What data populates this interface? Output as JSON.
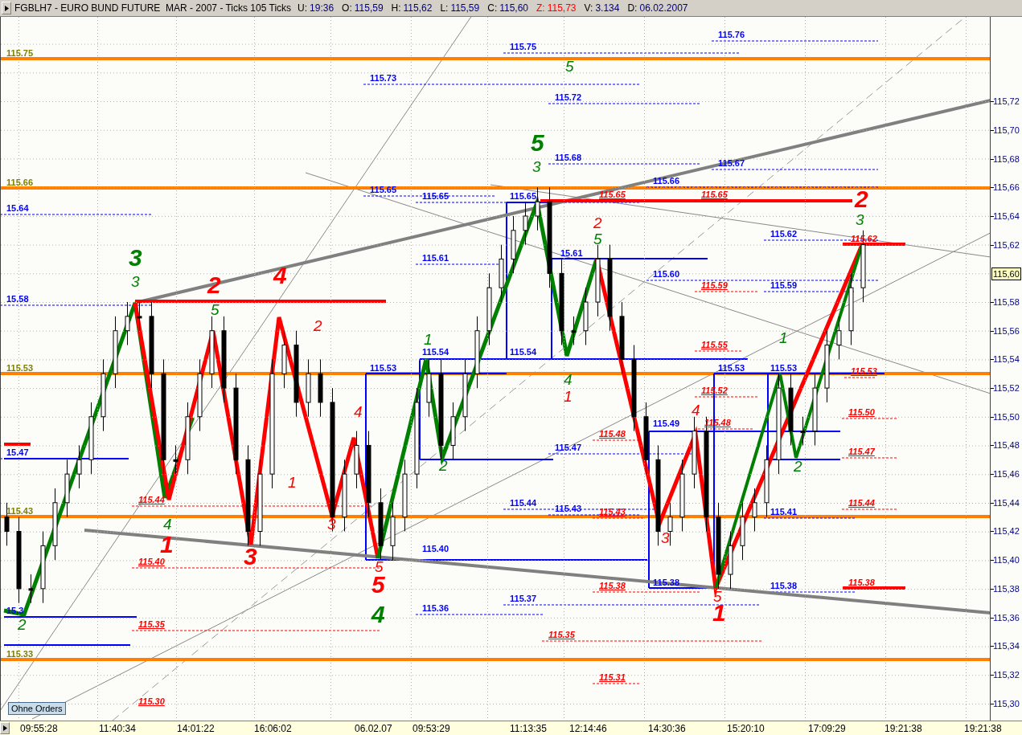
{
  "header": {
    "title": "FGBLH7 - EURO BUND FUTURE  MAR - 2007 - Ticks 105 Ticks",
    "fields": [
      {
        "label": "U:",
        "value": "19:36",
        "kind": "normal"
      },
      {
        "label": "O:",
        "value": "115,59",
        "kind": "normal"
      },
      {
        "label": "H:",
        "value": "115,62",
        "kind": "normal"
      },
      {
        "label": "L:",
        "value": "115,59",
        "kind": "normal"
      },
      {
        "label": "C:",
        "value": "115,60",
        "kind": "normal"
      },
      {
        "label": "Z:",
        "value": "115,73",
        "kind": "alert"
      },
      {
        "label": "V:",
        "value": "3.134",
        "kind": "normal"
      },
      {
        "label": "D:",
        "value": "06.02.2007",
        "kind": "normal"
      }
    ]
  },
  "level_labels": [
    {
      "text": "115.75",
      "kind": "pivot"
    },
    {
      "text": "115.66",
      "kind": "pivot"
    },
    {
      "text": "115.53",
      "kind": "pivot"
    },
    {
      "text": "115.43",
      "kind": "pivot"
    },
    {
      "text": "115.33",
      "kind": "pivot"
    },
    {
      "text": "115.76",
      "kind": "blue"
    },
    {
      "text": "115.75",
      "kind": "blue"
    },
    {
      "text": "115.73",
      "kind": "blue"
    },
    {
      "text": "115.72",
      "kind": "blue"
    },
    {
      "text": "115.68",
      "kind": "blue"
    },
    {
      "text": "115.67",
      "kind": "blue"
    },
    {
      "text": "115.66",
      "kind": "blue"
    },
    {
      "text": "115.65",
      "kind": "blue"
    },
    {
      "text": "115.65",
      "kind": "blue"
    },
    {
      "text": "115.65",
      "kind": "blue"
    },
    {
      "text": "15.64",
      "kind": "blue"
    },
    {
      "text": "115.62",
      "kind": "blue"
    },
    {
      "text": "115.61",
      "kind": "blue"
    },
    {
      "text": "15.61",
      "kind": "blue"
    },
    {
      "text": "115.60",
      "kind": "blue"
    },
    {
      "text": "115.59",
      "kind": "blue"
    },
    {
      "text": "15.58",
      "kind": "blue"
    },
    {
      "text": "115.54",
      "kind": "blue"
    },
    {
      "text": "115.54",
      "kind": "blue"
    },
    {
      "text": "115.53",
      "kind": "blue"
    },
    {
      "text": "115.53",
      "kind": "blue"
    },
    {
      "text": "115.53",
      "kind": "blue"
    },
    {
      "text": "115.49",
      "kind": "blue"
    },
    {
      "text": "115.47",
      "kind": "blue"
    },
    {
      "text": "15.47",
      "kind": "blue"
    },
    {
      "text": "115.44",
      "kind": "blue"
    },
    {
      "text": "115.43",
      "kind": "blue"
    },
    {
      "text": "115.41",
      "kind": "blue"
    },
    {
      "text": "115.40",
      "kind": "blue"
    },
    {
      "text": "115.38",
      "kind": "blue"
    },
    {
      "text": "115.38",
      "kind": "blue"
    },
    {
      "text": "115.37",
      "kind": "blue"
    },
    {
      "text": "115.36",
      "kind": "blue"
    },
    {
      "text": "15.3",
      "kind": "blue"
    },
    {
      "text": "115.65",
      "kind": "red"
    },
    {
      "text": "115.65",
      "kind": "red"
    },
    {
      "text": "115.62",
      "kind": "red"
    },
    {
      "text": "115.59",
      "kind": "red"
    },
    {
      "text": "115.55",
      "kind": "red"
    },
    {
      "text": "115.53",
      "kind": "red"
    },
    {
      "text": "115.52",
      "kind": "red"
    },
    {
      "text": "115.50",
      "kind": "red"
    },
    {
      "text": "115.48",
      "kind": "red"
    },
    {
      "text": "115.48",
      "kind": "red"
    },
    {
      "text": "115.47",
      "kind": "red"
    },
    {
      "text": "115.44",
      "kind": "red"
    },
    {
      "text": "115.44",
      "kind": "red"
    },
    {
      "text": "115.43",
      "kind": "red"
    },
    {
      "text": "115.40",
      "kind": "red"
    },
    {
      "text": "115.38",
      "kind": "red"
    },
    {
      "text": "115.38",
      "kind": "red"
    },
    {
      "text": "115.35",
      "kind": "red"
    },
    {
      "text": "115.35",
      "kind": "red"
    },
    {
      "text": "115.31",
      "kind": "red"
    },
    {
      "text": "115.30",
      "kind": "red"
    }
  ],
  "wave_labels": [
    {
      "text": "3",
      "kind": "major",
      "color": "#008000"
    },
    {
      "text": "5",
      "kind": "major",
      "color": "#008000"
    },
    {
      "text": "4",
      "kind": "major",
      "color": "#008000"
    },
    {
      "text": "3",
      "kind": "minor",
      "color": "#008000"
    },
    {
      "text": "5",
      "kind": "minor",
      "color": "#008000"
    },
    {
      "text": "4",
      "kind": "minor",
      "color": "#008000"
    },
    {
      "text": "2",
      "kind": "minor",
      "color": "#008000"
    },
    {
      "text": "1",
      "kind": "minor",
      "color": "#008000"
    },
    {
      "text": "2",
      "kind": "minor",
      "color": "#008000"
    },
    {
      "text": "3",
      "kind": "minor",
      "color": "#008000"
    },
    {
      "text": "5",
      "kind": "minor",
      "color": "#008000"
    },
    {
      "text": "5",
      "kind": "minor",
      "color": "#008000"
    },
    {
      "text": "4",
      "kind": "minor",
      "color": "#008000"
    },
    {
      "text": "1",
      "kind": "minor",
      "color": "#008000"
    },
    {
      "text": "2",
      "kind": "minor",
      "color": "#008000"
    },
    {
      "text": "3",
      "kind": "minor",
      "color": "#008000"
    },
    {
      "text": "2",
      "kind": "major",
      "color": "#ff0000"
    },
    {
      "text": "4",
      "kind": "major",
      "color": "#ff0000"
    },
    {
      "text": "1",
      "kind": "major",
      "color": "#ff0000"
    },
    {
      "text": "3",
      "kind": "major",
      "color": "#ff0000"
    },
    {
      "text": "5",
      "kind": "major",
      "color": "#ff0000"
    },
    {
      "text": "2",
      "kind": "major",
      "color": "#ff0000"
    },
    {
      "text": "1",
      "kind": "major",
      "color": "#ff0000"
    },
    {
      "text": "2",
      "kind": "minor",
      "color": "#ff0000"
    },
    {
      "text": "1",
      "kind": "minor",
      "color": "#ff0000"
    },
    {
      "text": "3",
      "kind": "minor",
      "color": "#ff0000"
    },
    {
      "text": "4",
      "kind": "minor",
      "color": "#ff0000"
    },
    {
      "text": "5",
      "kind": "minor",
      "color": "#ff0000"
    },
    {
      "text": "2",
      "kind": "minor",
      "color": "#ff0000"
    },
    {
      "text": "1",
      "kind": "minor",
      "color": "#ff0000"
    },
    {
      "text": "4",
      "kind": "minor",
      "color": "#ff0000"
    },
    {
      "text": "3",
      "kind": "minor",
      "color": "#ff0000"
    },
    {
      "text": "5",
      "kind": "minor",
      "color": "#ff0000"
    }
  ],
  "price_chart": {
    "chart_data": {
      "type": "candlestick",
      "categories": [
        null,
        null,
        null,
        null,
        null,
        null,
        null,
        null,
        null,
        null,
        null,
        null,
        null,
        null,
        null,
        null,
        null,
        null,
        null,
        null,
        null,
        null,
        null,
        null,
        null,
        null,
        null,
        null,
        null,
        null,
        null,
        null,
        null,
        null,
        null,
        null,
        null,
        null,
        null,
        null,
        null,
        null,
        null,
        null,
        null,
        null,
        null,
        null,
        null,
        null,
        null,
        null,
        null,
        null,
        null,
        null,
        null,
        null,
        null,
        null,
        null,
        null,
        null,
        null,
        null,
        null,
        null,
        null,
        null,
        null,
        null,
        null,
        null,
        null,
        null,
        null,
        null,
        null,
        null,
        null,
        null,
        null
      ],
      "ylim": [
        115.288,
        115.779
      ],
      "grid": true,
      "yticks": [
        {
          "value": 115.72,
          "label": "115,72"
        },
        {
          "value": 115.7,
          "label": "115,70"
        },
        {
          "value": 115.68,
          "label": "115,68"
        },
        {
          "value": 115.66,
          "label": "115,66"
        },
        {
          "value": 115.64,
          "label": "115,64"
        },
        {
          "value": 115.62,
          "label": "115,62"
        },
        {
          "value": 115.58,
          "label": "115,58"
        },
        {
          "value": 115.56,
          "label": "115,56"
        },
        {
          "value": 115.54,
          "label": "115,54"
        },
        {
          "value": 115.52,
          "label": "115,52"
        },
        {
          "value": 115.5,
          "label": "115,50"
        },
        {
          "value": 115.48,
          "label": "115,48"
        },
        {
          "value": 115.46,
          "label": "115,46"
        },
        {
          "value": 115.44,
          "label": "115,44"
        },
        {
          "value": 115.42,
          "label": "115,42"
        },
        {
          "value": 115.4,
          "label": "115,40"
        },
        {
          "value": 115.38,
          "label": "115,38"
        },
        {
          "value": 115.36,
          "label": "115,36"
        },
        {
          "value": 115.34,
          "label": "115,34"
        },
        {
          "value": 115.32,
          "label": "115,32"
        },
        {
          "value": 115.3,
          "label": "115,30"
        }
      ],
      "ohlc": [
        [
          115.43,
          115.44,
          115.41,
          115.42
        ],
        [
          115.42,
          115.43,
          115.37,
          115.38
        ],
        [
          115.38,
          115.39,
          115.37,
          115.38
        ],
        [
          115.38,
          115.42,
          115.37,
          115.41
        ],
        [
          115.41,
          115.45,
          115.4,
          115.44
        ],
        [
          115.44,
          115.47,
          115.43,
          115.46
        ],
        [
          115.46,
          115.48,
          115.45,
          115.47
        ],
        [
          115.47,
          115.51,
          115.46,
          115.5
        ],
        [
          115.5,
          115.54,
          115.49,
          115.53
        ],
        [
          115.53,
          115.57,
          115.52,
          115.56
        ],
        [
          115.56,
          115.58,
          115.55,
          115.57
        ],
        [
          115.57,
          115.58,
          115.56,
          115.57
        ],
        [
          115.57,
          115.58,
          115.52,
          115.53
        ],
        [
          115.53,
          115.54,
          115.46,
          115.47
        ],
        [
          115.47,
          115.48,
          115.46,
          115.47
        ],
        [
          115.47,
          115.51,
          115.46,
          115.5
        ],
        [
          115.5,
          115.54,
          115.49,
          115.53
        ],
        [
          115.53,
          115.57,
          115.52,
          115.56
        ],
        [
          115.56,
          115.57,
          115.51,
          115.52
        ],
        [
          115.52,
          115.53,
          115.46,
          115.47
        ],
        [
          115.47,
          115.48,
          115.41,
          115.42
        ],
        [
          115.42,
          115.47,
          115.41,
          115.46
        ],
        [
          115.46,
          115.54,
          115.45,
          115.53
        ],
        [
          115.53,
          115.56,
          115.52,
          115.55
        ],
        [
          115.55,
          115.56,
          115.5,
          115.51
        ],
        [
          115.51,
          115.54,
          115.5,
          115.53
        ],
        [
          115.53,
          115.54,
          115.5,
          115.51
        ],
        [
          115.51,
          115.52,
          115.42,
          115.43
        ],
        [
          115.43,
          115.47,
          115.42,
          115.46
        ],
        [
          115.46,
          115.49,
          115.45,
          115.48
        ],
        [
          115.48,
          115.49,
          115.43,
          115.44
        ],
        [
          115.44,
          115.45,
          115.4,
          115.41
        ],
        [
          115.41,
          115.44,
          115.4,
          115.43
        ],
        [
          115.43,
          115.47,
          115.42,
          115.46
        ],
        [
          115.46,
          115.52,
          115.45,
          115.51
        ],
        [
          115.51,
          115.54,
          115.5,
          115.53
        ],
        [
          115.53,
          115.54,
          115.47,
          115.48
        ],
        [
          115.48,
          115.51,
          115.47,
          115.5
        ],
        [
          115.5,
          115.54,
          115.49,
          115.53
        ],
        [
          115.53,
          115.57,
          115.52,
          115.56
        ],
        [
          115.56,
          115.6,
          115.55,
          115.59
        ],
        [
          115.59,
          115.62,
          115.58,
          115.61
        ],
        [
          115.61,
          115.64,
          115.6,
          115.63
        ],
        [
          115.63,
          115.65,
          115.62,
          115.64
        ],
        [
          115.64,
          115.66,
          115.63,
          115.65
        ],
        [
          115.65,
          115.66,
          115.59,
          115.6
        ],
        [
          115.6,
          115.61,
          115.55,
          115.56
        ],
        [
          115.56,
          115.57,
          115.55,
          115.56
        ],
        [
          115.56,
          115.59,
          115.55,
          115.58
        ],
        [
          115.58,
          115.62,
          115.57,
          115.61
        ],
        [
          115.61,
          115.62,
          115.56,
          115.57
        ],
        [
          115.57,
          115.58,
          115.53,
          115.54
        ],
        [
          115.54,
          115.55,
          115.49,
          115.5
        ],
        [
          115.5,
          115.51,
          115.46,
          115.47
        ],
        [
          115.47,
          115.48,
          115.41,
          115.42
        ],
        [
          115.42,
          115.44,
          115.41,
          115.43
        ],
        [
          115.43,
          115.47,
          115.42,
          115.46
        ],
        [
          115.46,
          115.5,
          115.45,
          115.49
        ],
        [
          115.49,
          115.5,
          115.42,
          115.43
        ],
        [
          115.43,
          115.44,
          115.38,
          115.39
        ],
        [
          115.39,
          115.42,
          115.38,
          115.41
        ],
        [
          115.41,
          115.44,
          115.4,
          115.43
        ],
        [
          115.43,
          115.45,
          115.42,
          115.44
        ],
        [
          115.44,
          115.48,
          115.43,
          115.47
        ],
        [
          115.47,
          115.53,
          115.46,
          115.52
        ],
        [
          115.52,
          115.53,
          115.48,
          115.49
        ],
        [
          115.49,
          115.5,
          115.48,
          115.49
        ],
        [
          115.49,
          115.53,
          115.48,
          115.52
        ],
        [
          115.52,
          115.56,
          115.51,
          115.55
        ],
        [
          115.55,
          115.57,
          115.54,
          115.56
        ],
        [
          115.56,
          115.6,
          115.55,
          115.59
        ],
        [
          115.59,
          115.63,
          115.58,
          115.62
        ],
        null,
        null,
        null,
        null,
        null,
        null,
        null,
        null,
        null,
        null
      ]
    }
  },
  "orders_button": "Ohne Orders",
  "y_axis": {
    "current_price": "115,60"
  },
  "x_axis": {
    "labels": [
      "09:55:28",
      "11:40:34",
      "14:01:22",
      "16:06:02",
      "06.02.07",
      "09:53:29",
      "11:13:35",
      "12:14:46",
      "14:30:36",
      "15:20:10",
      "17:09:29",
      "19:21:38",
      "19:21:38"
    ]
  }
}
